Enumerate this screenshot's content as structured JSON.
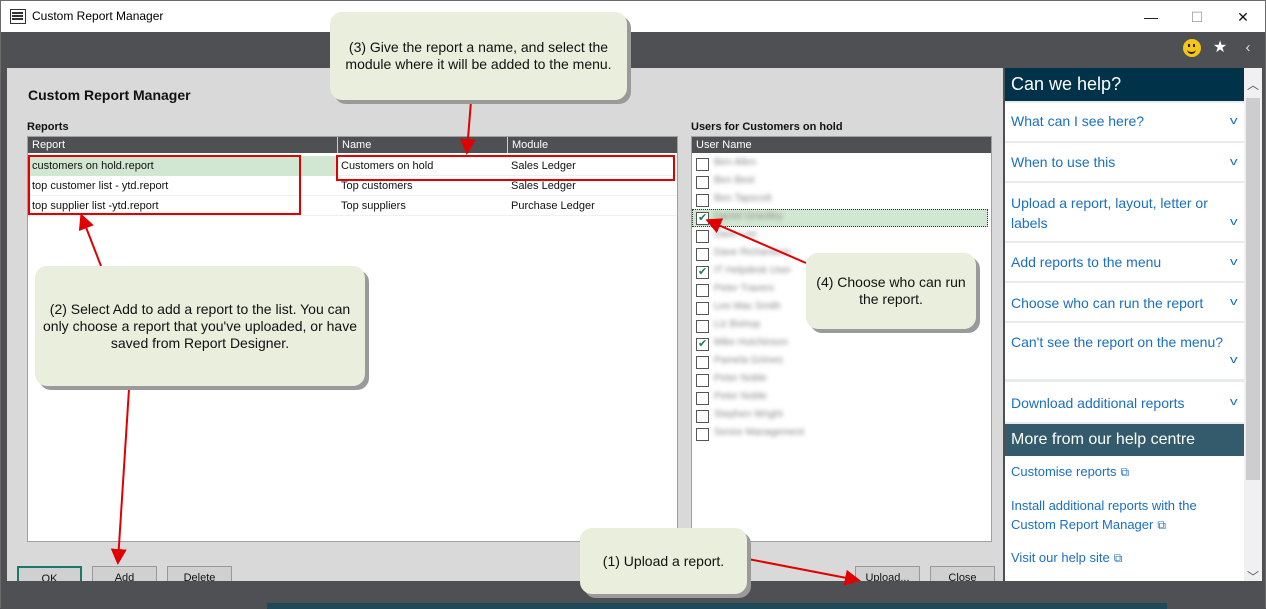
{
  "window": {
    "title": "Custom Report Manager",
    "controls": {
      "minimize": "—",
      "maximize": "☐",
      "close": "✕"
    }
  },
  "toolbar": {
    "icons": [
      "smiley-feedback-icon",
      "favorite-star-icon",
      "collapse-panel-icon"
    ],
    "star_glyph": "★",
    "collapse_glyph": "‹"
  },
  "main": {
    "heading": "Custom Report Manager",
    "reports_label": "Reports",
    "reports_columns": [
      "Report",
      "Name",
      "Module"
    ],
    "reports_rows": [
      {
        "report": "customers on hold.report",
        "name": "Customers on hold",
        "module": "Sales Ledger",
        "selected": true
      },
      {
        "report": "top customer list - ytd.report",
        "name": "Top customers",
        "module": "Sales Ledger",
        "selected": false
      },
      {
        "report": "top supplier list -ytd.report",
        "name": "Top suppliers",
        "module": "Purchase Ledger",
        "selected": false
      }
    ],
    "users_label": "Users for Customers on hold",
    "users_column": "User Name",
    "users": [
      {
        "name": "Ben Allen",
        "checked": false
      },
      {
        "name": "Ben Best",
        "checked": false
      },
      {
        "name": "Ben Tapscott",
        "checked": false
      },
      {
        "name": "Daniel Grantley",
        "checked": true,
        "selected": true
      },
      {
        "name": "Dave Lee",
        "checked": false
      },
      {
        "name": "Dave Richardson",
        "checked": false
      },
      {
        "name": "IT Helpdesk User",
        "checked": true
      },
      {
        "name": "Peter Travers",
        "checked": false
      },
      {
        "name": "Lee Mac Smith",
        "checked": false
      },
      {
        "name": "Liz Bishop",
        "checked": false
      },
      {
        "name": "Mike Hutchinson",
        "checked": true
      },
      {
        "name": "Pamela Grimes",
        "checked": false
      },
      {
        "name": "Peter Noble",
        "checked": false
      },
      {
        "name": "Peter Noble",
        "checked": false
      },
      {
        "name": "Stephen Wright",
        "checked": false
      },
      {
        "name": "Senior Management",
        "checked": false
      }
    ],
    "buttons": {
      "ok": "OK",
      "add_accel": "A",
      "add_rest": "dd",
      "delete_accel": "D",
      "delete_rest": "elete",
      "upload_accel": "U",
      "upload_rest": "pload...",
      "close_accel": "C",
      "close_rest": "lose"
    }
  },
  "help_panel": {
    "heading": "Can we help?",
    "accordion": [
      "What can I see here?",
      "When to use this",
      "Upload a report, layout, letter or labels",
      "Add reports to the menu",
      "Choose who can run the report",
      "Can't see the report on the menu?",
      "Download additional reports"
    ],
    "more_heading": "More from our help centre",
    "links": [
      "Customise reports",
      "Install additional reports with the Custom Report Manager",
      "Visit our help site"
    ],
    "external_glyph": "⧉"
  },
  "callouts": {
    "step1": "(1) Upload a report.",
    "step2": "(2) Select Add to add a report to the list. You can only choose a report that you've uploaded, or have saved from Report Designer.",
    "step3": "(3) Give the report a name, and select the module where it will be added to the menu.",
    "step4": "(4) Choose who can run the report."
  },
  "colors": {
    "accent_dark": "#00324a",
    "link_blue": "#1a6fbf",
    "selected_row": "#d1e7d1",
    "annotation_red": "#e00000",
    "callout_bg": "#eaeedc"
  }
}
